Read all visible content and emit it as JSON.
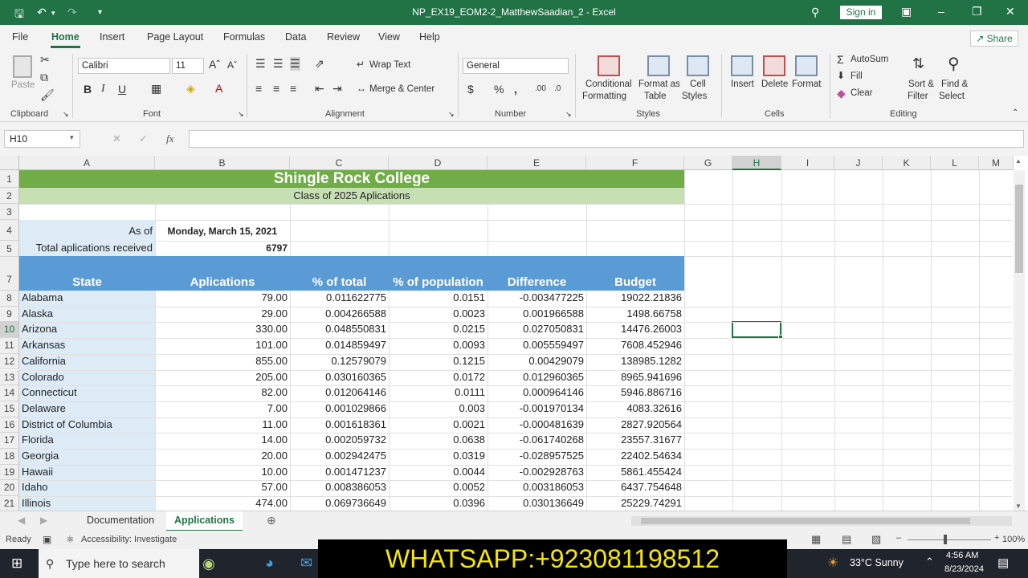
{
  "title_bar": {
    "doc_title": "NP_EX19_EOM2-2_MatthewSaadian_2  -  Excel",
    "sign_in": "Sign in",
    "save_icon": "save-icon",
    "undo_icon": "undo-icon",
    "redo_icon": "redo-icon"
  },
  "tabs": [
    "File",
    "Home",
    "Insert",
    "Page Layout",
    "Formulas",
    "Data",
    "Review",
    "View",
    "Help"
  ],
  "share_label": "Share",
  "ribbon": {
    "paste": "Paste",
    "clipboard": "Clipboard",
    "font_name": "Calibri",
    "font_size": "11",
    "font": "Font",
    "wrap_text": "Wrap Text",
    "merge_center": "Merge & Center",
    "alignment": "Alignment",
    "number_format": "General",
    "number": "Number",
    "conditional_formatting": [
      "Conditional",
      "Formatting"
    ],
    "format_as_table": [
      "Format as",
      "Table"
    ],
    "cell_styles": [
      "Cell",
      "Styles"
    ],
    "styles": "Styles",
    "insert": "Insert",
    "delete": "Delete",
    "format": "Format",
    "cells": "Cells",
    "autosum": "AutoSum",
    "fill": "Fill",
    "clear": "Clear",
    "sort_filter": [
      "Sort &",
      "Filter"
    ],
    "find_select": [
      "Find &",
      "Select"
    ],
    "editing": "Editing"
  },
  "formula_bar": {
    "name_box": "H10",
    "fx": "fx",
    "formula": ""
  },
  "columns": [
    "A",
    "B",
    "C",
    "D",
    "E",
    "F",
    "G",
    "H",
    "I",
    "J",
    "K",
    "L",
    "M"
  ],
  "sheet": {
    "title": "Shingle Rock College",
    "subtitle": "Class of 2025 Aplications",
    "as_of_label": "As of",
    "as_of_value": "Monday, March 15, 2021",
    "total_label": "Total aplications received",
    "total_value": "6797",
    "headers": [
      "State",
      "Aplications",
      "% of total",
      "% of population",
      "Difference",
      "Budget"
    ],
    "rows": [
      [
        "Alabama",
        "79.00",
        "0.011622775",
        "0.0151",
        "-0.003477225",
        "19022.21836"
      ],
      [
        "Alaska",
        "29.00",
        "0.004266588",
        "0.0023",
        "0.001966588",
        "1498.66758"
      ],
      [
        "Arizona",
        "330.00",
        "0.048550831",
        "0.0215",
        "0.027050831",
        "14476.26003"
      ],
      [
        "Arkansas",
        "101.00",
        "0.014859497",
        "0.0093",
        "0.005559497",
        "7608.452946"
      ],
      [
        "California",
        "855.00",
        "0.12579079",
        "0.1215",
        "0.00429079",
        "138985.1282"
      ],
      [
        "Colorado",
        "205.00",
        "0.030160365",
        "0.0172",
        "0.012960365",
        "8965.941696"
      ],
      [
        "Connecticut",
        "82.00",
        "0.012064146",
        "0.0111",
        "0.000964146",
        "5946.886716"
      ],
      [
        "Delaware",
        "7.00",
        "0.001029866",
        "0.003",
        "-0.001970134",
        "4083.32616"
      ],
      [
        "District of Columbia",
        "11.00",
        "0.001618361",
        "0.0021",
        "-0.000481639",
        "2827.920564"
      ],
      [
        "Florida",
        "14.00",
        "0.002059732",
        "0.0638",
        "-0.061740268",
        "23557.31677"
      ],
      [
        "Georgia",
        "20.00",
        "0.002942475",
        "0.0319",
        "-0.028957525",
        "22402.54634"
      ],
      [
        "Hawaii",
        "10.00",
        "0.001471237",
        "0.0044",
        "-0.002928763",
        "5861.455424"
      ],
      [
        "Idaho",
        "57.00",
        "0.008386053",
        "0.0052",
        "0.003186053",
        "6437.754648"
      ],
      [
        "Illinois",
        "474.00",
        "0.069736649",
        "0.0396",
        "0.030136649",
        "25229.74291"
      ]
    ]
  },
  "sheet_tabs": [
    "Documentation",
    "Applications"
  ],
  "status": {
    "ready": "Ready",
    "accessibility": "Accessibility: Investigate",
    "zoom": "100%"
  },
  "taskbar": {
    "search_placeholder": "Type here to search",
    "weather": "33°C  Sunny",
    "time": "4:56 AM",
    "date": "8/23/2024"
  },
  "overlay_text": "WHATSAPP:+923081198512"
}
